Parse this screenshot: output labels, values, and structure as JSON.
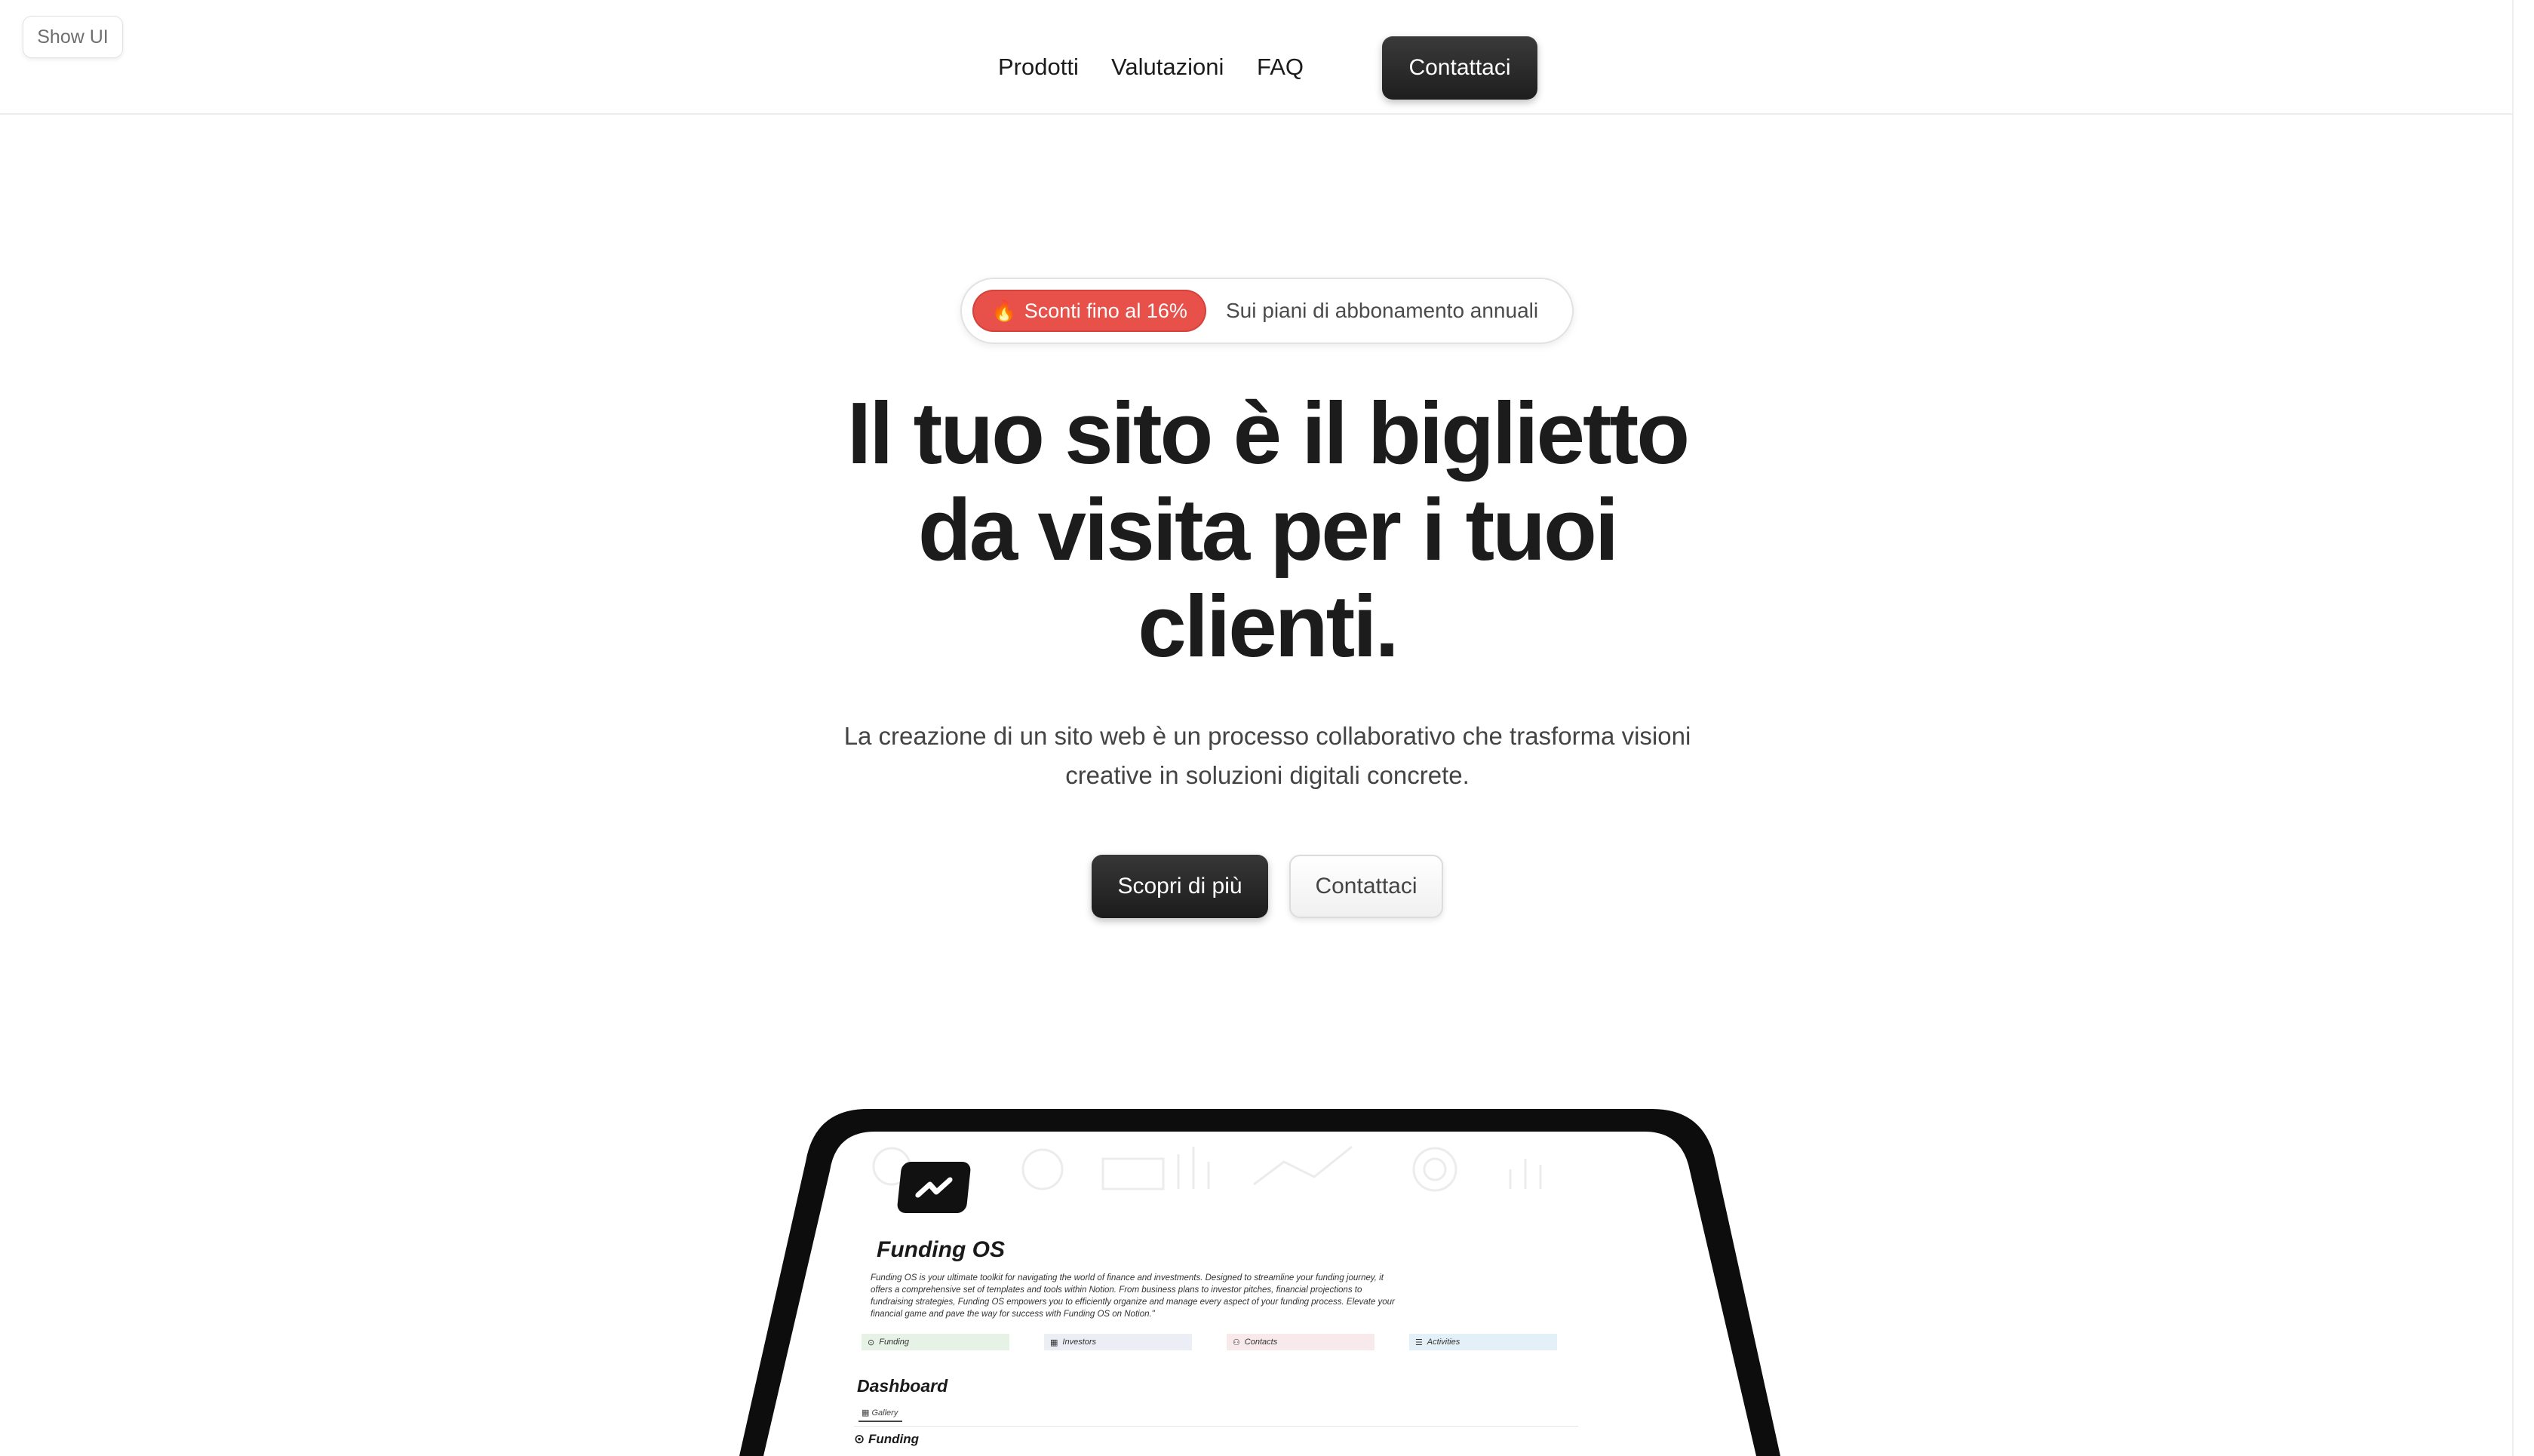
{
  "top": {
    "show_ui_label": "Show UI"
  },
  "nav": {
    "items": [
      {
        "label": "Prodotti"
      },
      {
        "label": "Valutazioni"
      },
      {
        "label": "FAQ"
      }
    ],
    "contact_label": "Contattaci"
  },
  "promo": {
    "badge_icon": "🔥",
    "badge_text": "Sconti fino al 16%",
    "text": "Sui piani di abbonamento annuali",
    "badge_color": "#e8504a"
  },
  "hero": {
    "title_lines": [
      "Il tuo sito è il biglietto",
      "da visita per i tuoi",
      "clienti."
    ],
    "subtitle_lines": [
      "La creazione di un sito web è un processo collaborativo che trasforma visioni",
      "creative in soluzioni digitali concrete."
    ],
    "primary_button": "Scopri di più",
    "secondary_button": "Contattaci"
  },
  "preview": {
    "logo_icon": "chart-trend-icon",
    "title": "Funding OS",
    "description_lines": [
      "Funding OS is your ultimate toolkit for navigating the world of finance and investments. Designed to streamline your funding journey, it",
      "offers a comprehensive set of templates and tools within Notion. From business plans to investor pitches, financial projections to",
      "fundraising strategies, Funding OS empowers you to efficiently organize and manage every aspect of your funding process. Elevate your",
      "financial game and pave the way for success with Funding OS on Notion.\""
    ],
    "tabs": [
      {
        "icon": "⊙",
        "label": "Funding",
        "color": "#e6f2e6"
      },
      {
        "icon": "▦",
        "label": "Investors",
        "color": "#eceef5"
      },
      {
        "icon": "⚇",
        "label": "Contacts",
        "color": "#f8e9ea"
      },
      {
        "icon": "☰",
        "label": "Activities",
        "color": "#e4f0f7"
      }
    ],
    "dashboard_title": "Dashboard",
    "gallery_label": "Gallery",
    "funding_heading": "Funding"
  },
  "colors": {
    "accent_dark": "#1e1e1e",
    "background": "#ffffff"
  }
}
